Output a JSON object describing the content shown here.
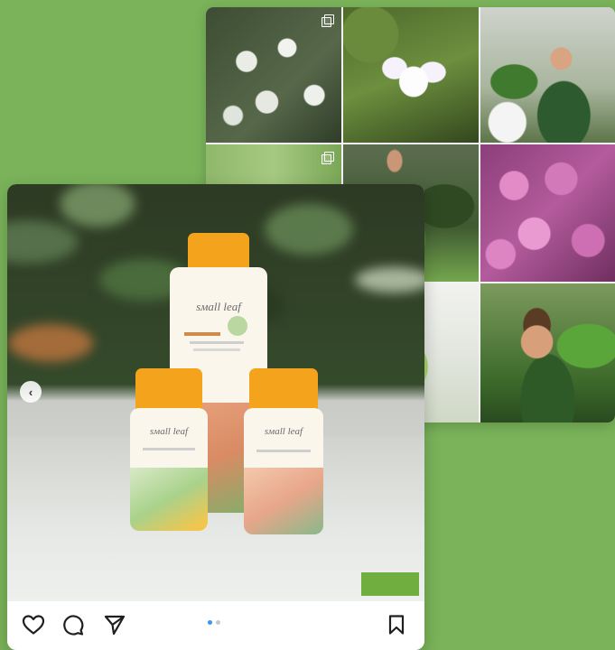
{
  "colors": {
    "page_background": "#7ab35a",
    "bottle_cap": "#f4a31c",
    "like_active": "#3897f0"
  },
  "grid": {
    "tiles": [
      {
        "name": "grid-tile-white-flowers",
        "icon": "multi-image-icon"
      },
      {
        "name": "grid-tile-iris-flower",
        "icon": "none"
      },
      {
        "name": "grid-tile-man-with-plant",
        "icon": "none"
      },
      {
        "name": "grid-tile-greenery",
        "icon": "multi-image-icon"
      },
      {
        "name": "grid-tile-man-greenery",
        "icon": "none"
      },
      {
        "name": "grid-tile-pink-flowers",
        "icon": "none"
      },
      {
        "name": "grid-tile-leafy-plant",
        "icon": "none"
      },
      {
        "name": "grid-tile-man-smiling",
        "icon": "none"
      }
    ]
  },
  "post": {
    "prev_icon": "chevron-left-icon",
    "carousel": {
      "total": 2,
      "active_index": 0
    },
    "actions": {
      "like_icon": "heart-icon",
      "comment_icon": "comment-icon",
      "share_icon": "send-icon",
      "save_icon": "bookmark-icon"
    }
  }
}
